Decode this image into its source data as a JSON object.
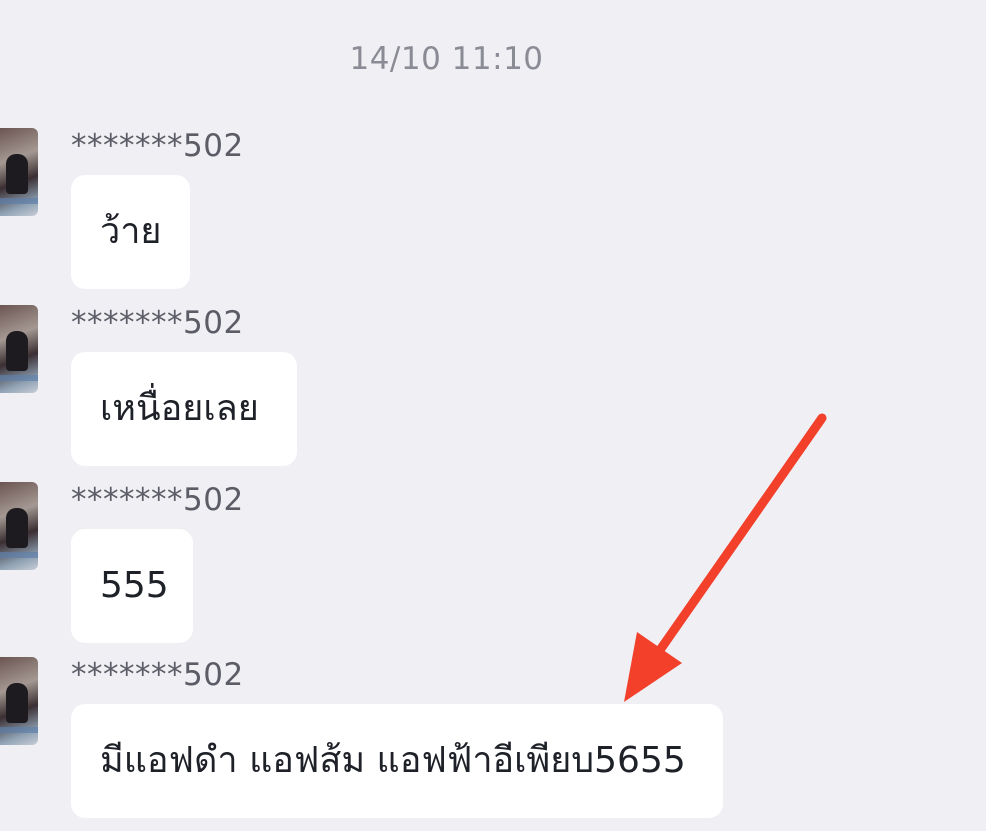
{
  "chat": {
    "timestamp": "14/10 11:10",
    "messages": [
      {
        "sender": "*******502",
        "text": "ว้าย"
      },
      {
        "sender": "*******502",
        "text": "เหนื่อยเลย"
      },
      {
        "sender": "*******502",
        "text": "555"
      },
      {
        "sender": "*******502",
        "text": "มีแอฟดำ แอฟส้ม แอฟฟ้าอีเพียบ5655"
      }
    ]
  },
  "annotation": {
    "arrow_color": "#f2402b"
  },
  "colors": {
    "background": "#efeff4",
    "bubble": "#ffffff",
    "text": "#1f2129",
    "meta_text": "#8a8b94"
  }
}
